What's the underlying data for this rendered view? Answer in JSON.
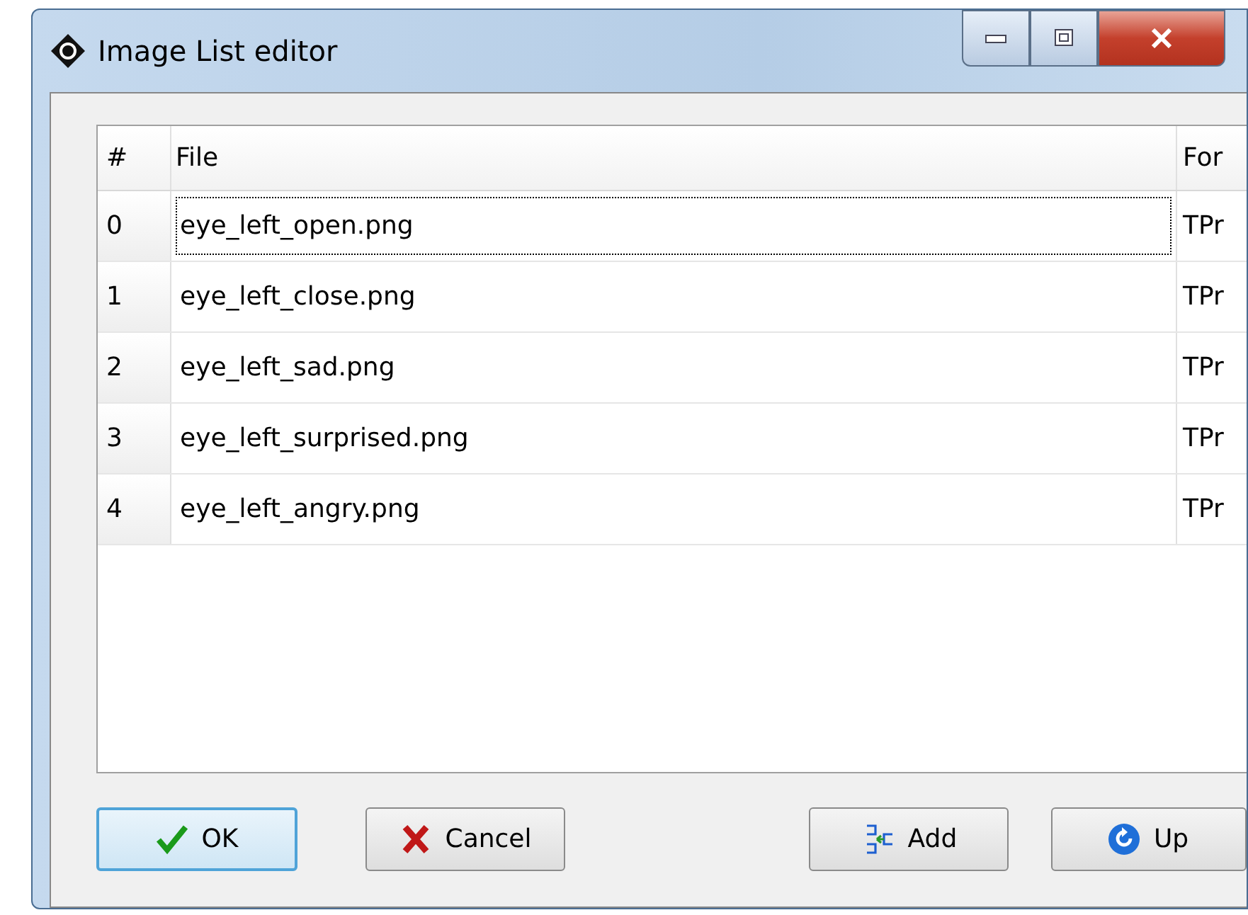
{
  "window": {
    "title": "Image List editor"
  },
  "table": {
    "columns": [
      "#",
      "File",
      "For"
    ],
    "rows": [
      {
        "index": "0",
        "file": "eye_left_open.png",
        "column_3": "TPr",
        "focused": true
      },
      {
        "index": "1",
        "file": "eye_left_close.png",
        "column_3": "TPr",
        "focused": false
      },
      {
        "index": "2",
        "file": "eye_left_sad.png",
        "column_3": "TPr",
        "focused": false
      },
      {
        "index": "3",
        "file": "eye_left_surprised.png",
        "column_3": "TPr",
        "focused": false
      },
      {
        "index": "4",
        "file": "eye_left_angry.png",
        "column_3": "TPr",
        "focused": false
      }
    ]
  },
  "buttons": [
    {
      "kind": "ok",
      "label": "OK",
      "default": true
    },
    {
      "kind": "cancel",
      "label": "Cancel",
      "default": false
    },
    {
      "kind": "add",
      "label": "Add",
      "default": false
    },
    {
      "kind": "up",
      "label": "Up",
      "default": false
    }
  ]
}
